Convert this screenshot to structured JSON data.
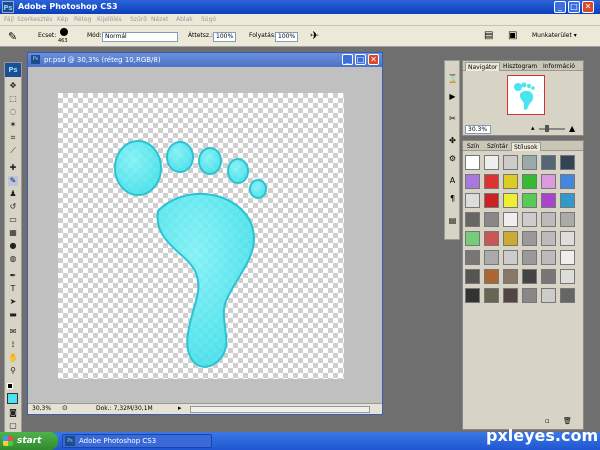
{
  "app": {
    "title": "Adobe Photoshop CS3",
    "logo": "Ps"
  },
  "menu": [
    "Fájl",
    "Szerkesztés",
    "Kép",
    "Réteg",
    "Kijelölés",
    "Szűrő",
    "Nézet",
    "Ablak",
    "Súgó"
  ],
  "options": {
    "brush_label": "Ecset:",
    "brush_size": "463",
    "mode_label": "Mód:",
    "mode_value": "Normál",
    "opacity_label": "Áttetsz.:",
    "opacity_value": "100%",
    "flow_label": "Folyatás:",
    "flow_value": "100%",
    "workspace_label": "Munkaterület ▾"
  },
  "document": {
    "title": "pr.psd @ 30,3% (réteg 10,RGB/8)",
    "zoom": "30,3%",
    "doc_info": "Dok.: 7,32M/30,1M"
  },
  "navigator": {
    "tabs": [
      "Navigátor",
      "Hisztogram",
      "Információ"
    ],
    "zoom": "30.3%"
  },
  "styles": {
    "tabs": [
      "Szín",
      "Színtár",
      "Stílusok"
    ]
  },
  "taskbar": {
    "start": "start",
    "item": "Adobe Photoshop CS3"
  },
  "watermark": "pxleyes.com",
  "colors": {
    "foot": "#47e5ef",
    "foot_edge": "#2bc3d4",
    "titlebar": "#0a3fbd",
    "start": "#2f8b2d"
  }
}
